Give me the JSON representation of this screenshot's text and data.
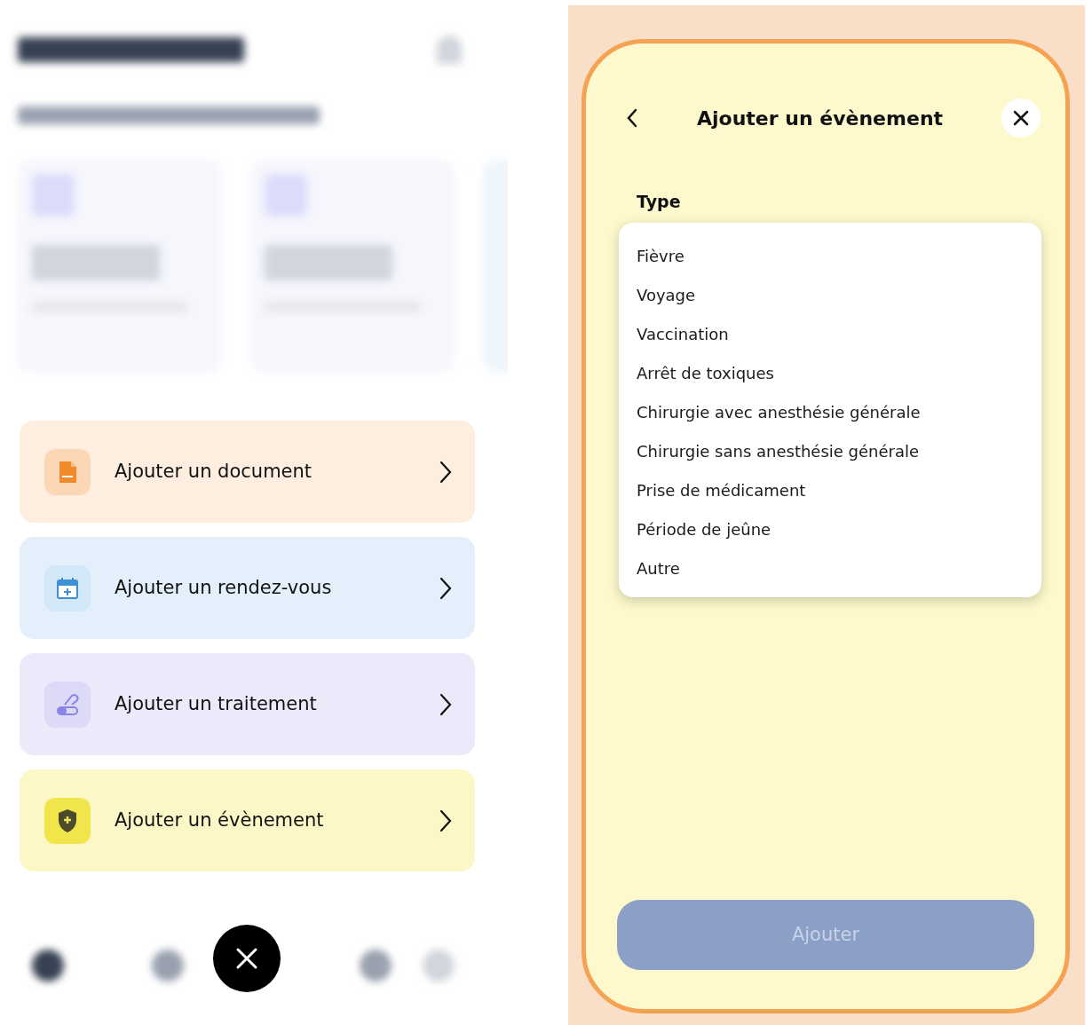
{
  "actions_menu": {
    "items": [
      {
        "kind": "document",
        "label": "Ajouter un document",
        "color": "#fdeee0"
      },
      {
        "kind": "appointment",
        "label": "Ajouter un rendez-vous",
        "color": "#e3f0fb"
      },
      {
        "kind": "treatment",
        "label": "Ajouter un traitement",
        "color": "#ebeafa"
      },
      {
        "kind": "event",
        "label": "Ajouter un évènement",
        "color": "#fcf7c6"
      }
    ]
  },
  "event_dialog": {
    "title": "Ajouter un évènement",
    "field_label": "Type",
    "options": [
      "Fièvre",
      "Voyage",
      "Vaccination",
      "Arrêt de toxiques",
      "Chirurgie avec anesthésie générale",
      "Chirurgie sans anesthésie générale",
      "Prise de médicament",
      "Période de jeûne",
      "Autre"
    ],
    "submit": {
      "label": "Ajouter",
      "disabled": true
    }
  }
}
